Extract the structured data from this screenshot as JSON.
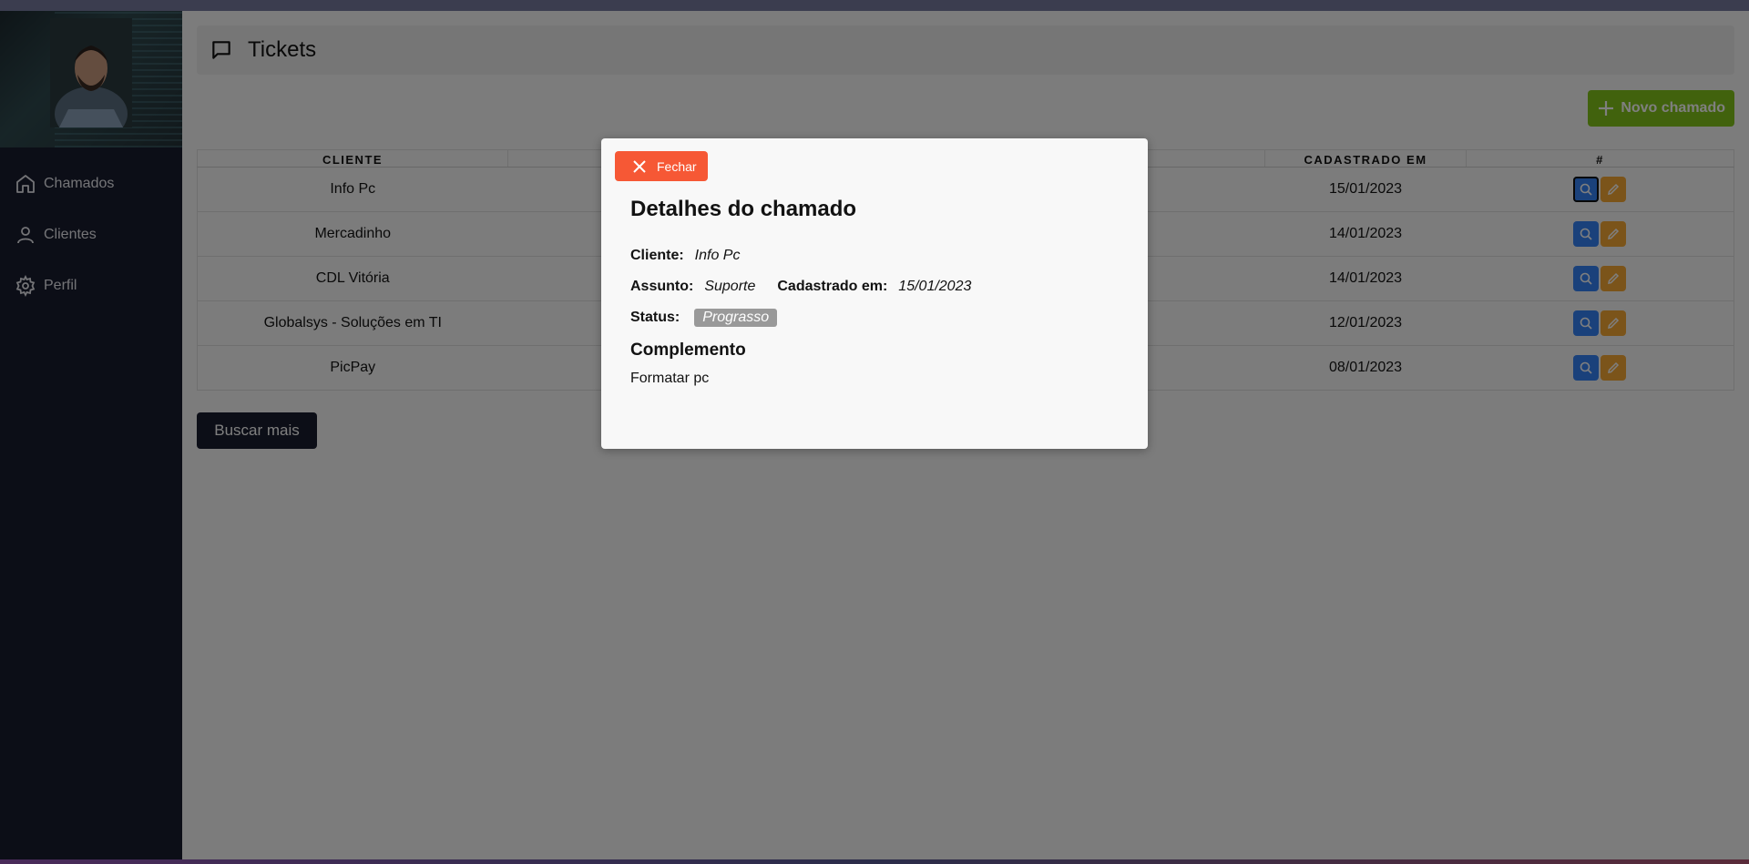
{
  "sidebar": {
    "items": [
      {
        "label": "Chamados",
        "icon": "home-icon"
      },
      {
        "label": "Clientes",
        "icon": "user-icon"
      },
      {
        "label": "Perfil",
        "icon": "gear-icon"
      }
    ]
  },
  "header": {
    "title": "Tickets",
    "icon": "message-icon"
  },
  "new_button": {
    "label": "Novo chamado",
    "icon": "plus-icon"
  },
  "table": {
    "columns": [
      "CLIENTE",
      "CADASTRADO EM",
      "#"
    ],
    "rows": [
      {
        "cliente": "Info Pc",
        "cadastrado": "15/01/2023"
      },
      {
        "cliente": "Mercadinho",
        "cadastrado": "14/01/2023"
      },
      {
        "cliente": "CDL Vitória",
        "cadastrado": "14/01/2023"
      },
      {
        "cliente": "Globalsys - Soluções em TI",
        "cadastrado": "12/01/2023"
      },
      {
        "cliente": "PicPay",
        "cadastrado": "08/01/2023"
      }
    ]
  },
  "more_button": {
    "label": "Buscar mais"
  },
  "modal": {
    "close_label": "Fechar",
    "title": "Detalhes do chamado",
    "cliente_label": "Cliente:",
    "cliente_value": "Info Pc",
    "assunto_label": "Assunto:",
    "assunto_value": "Suporte",
    "cadastrado_label": "Cadastrado em:",
    "cadastrado_value": "15/01/2023",
    "status_label": "Status:",
    "status_value": "Prograsso",
    "complemento_title": "Complemento",
    "complemento_text": "Formatar pc"
  },
  "colors": {
    "sidebar": "#181c2e",
    "accent_green": "#83c51a",
    "view_blue": "#3583f6",
    "edit_orange": "#f6a935",
    "close_red": "#f65835",
    "status_grey": "#999999"
  }
}
